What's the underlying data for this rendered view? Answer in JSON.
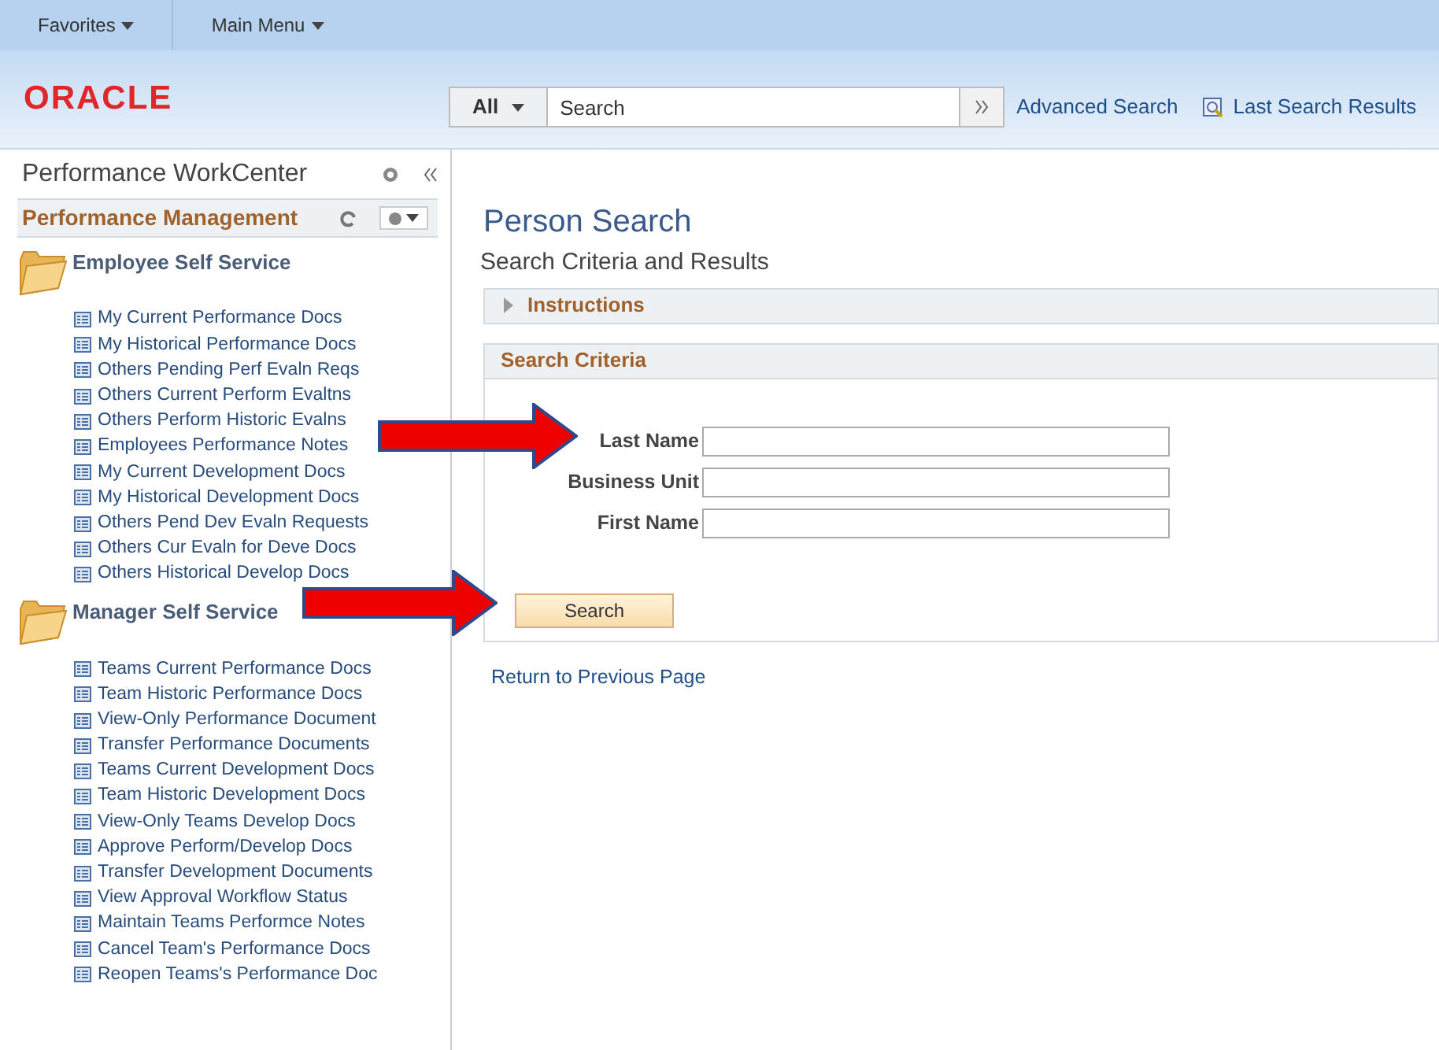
{
  "top_menu": [
    {
      "label": "Favorites"
    },
    {
      "label": "Main Menu"
    }
  ],
  "header": {
    "logo": "ORACLE",
    "search_scope": "All",
    "search": {
      "placeholder": "Search"
    },
    "advanced_search": "Advanced Search",
    "last_search_results": "Last Search Results"
  },
  "sidebar": {
    "title": "Performance WorkCenter",
    "section": "Performance Management",
    "groups": [
      {
        "title": "Employee Self Service",
        "items": [
          "My Current Performance Docs",
          "My Historical Performance Docs",
          "Others Pending Perf Evaln Reqs",
          "Others Current Perform Evaltns",
          "Others Perform Historic Evalns",
          "Employees Performance Notes",
          "My Current Development Docs",
          "My Historical Development Docs",
          "Others Pend Dev Evaln Requests",
          "Others Cur Evaln for Deve Docs",
          "Others Historical Develop Docs"
        ]
      },
      {
        "title": "Manager Self Service",
        "items": [
          "Teams Current Performance Docs",
          "Team Historic Performance Docs",
          "View-Only Performance Document",
          "Transfer Performance Documents",
          "Teams Current Development Docs",
          "Team Historic Development Docs",
          "View-Only Teams Develop Docs",
          "Approve Perform/Develop Docs",
          "Transfer Development Documents",
          "View Approval Workflow Status",
          "Maintain Teams Performce Notes",
          "Cancel Team's Performance Docs",
          "Reopen Teams's Performance Doc"
        ]
      }
    ]
  },
  "main": {
    "title": "Person Search",
    "subtitle": "Search Criteria and Results",
    "instructions": {
      "label": "Instructions",
      "expanded": false
    },
    "criteria_title": "Search Criteria",
    "fields": [
      {
        "label": "Last Name"
      },
      {
        "label": "Business Unit"
      },
      {
        "label": "First Name"
      }
    ],
    "search_button": "Search",
    "return_link": "Return to Previous Page"
  }
}
